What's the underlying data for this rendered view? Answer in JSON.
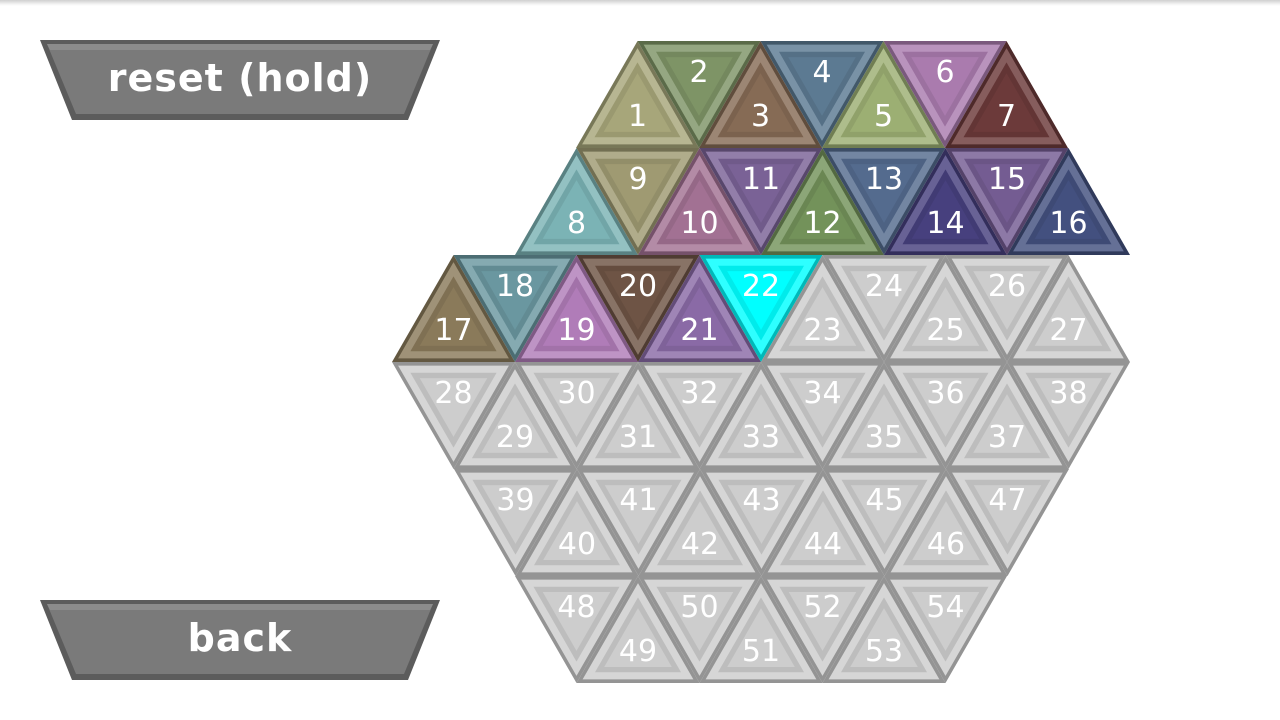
{
  "buttons": {
    "reset_label": "reset (hold)",
    "back_label": "back"
  },
  "colors": {
    "button_face": "#7a7a7a",
    "button_edge": "#5c5c5c",
    "empty_tile": "#cdcdcd",
    "selected_tile": "#00ffff",
    "label": "#ffffff"
  },
  "board": {
    "shape": "hexagon",
    "rows": [
      {
        "first": 1,
        "count": 7,
        "first_points_up": true
      },
      {
        "first": 8,
        "count": 9,
        "first_points_up": true
      },
      {
        "first": 17,
        "count": 11,
        "first_points_up": true
      },
      {
        "first": 28,
        "count": 11,
        "first_points_up": false
      },
      {
        "first": 39,
        "count": 9,
        "first_points_up": false
      },
      {
        "first": 48,
        "count": 7,
        "first_points_up": false
      }
    ],
    "selected_tile": 22,
    "tiles": [
      {
        "n": 1,
        "color": "#a7a67a"
      },
      {
        "n": 2,
        "color": "#7e9466"
      },
      {
        "n": 3,
        "color": "#866b55"
      },
      {
        "n": 4,
        "color": "#5c7a92"
      },
      {
        "n": 5,
        "color": "#9caf73"
      },
      {
        "n": 6,
        "color": "#aa7bae"
      },
      {
        "n": 7,
        "color": "#6c3a3a"
      },
      {
        "n": 8,
        "color": "#7bb3b5"
      },
      {
        "n": 9,
        "color": "#9f9a72"
      },
      {
        "n": 10,
        "color": "#a27193"
      },
      {
        "n": 11,
        "color": "#7a6296"
      },
      {
        "n": 12,
        "color": "#73925a"
      },
      {
        "n": 13,
        "color": "#546b8e"
      },
      {
        "n": 14,
        "color": "#47407e"
      },
      {
        "n": 15,
        "color": "#745c92"
      },
      {
        "n": 16,
        "color": "#43507f"
      },
      {
        "n": 17,
        "color": "#8a7a5a"
      },
      {
        "n": 18,
        "color": "#6a97a0"
      },
      {
        "n": 19,
        "color": "#b07cb8"
      },
      {
        "n": 20,
        "color": "#6e5445"
      },
      {
        "n": 21,
        "color": "#8a6aa6"
      },
      {
        "n": 22,
        "color": "#00ffff"
      },
      {
        "n": 23,
        "color": "#cdcdcd"
      },
      {
        "n": 24,
        "color": "#cdcdcd"
      },
      {
        "n": 25,
        "color": "#cdcdcd"
      },
      {
        "n": 26,
        "color": "#cdcdcd"
      },
      {
        "n": 27,
        "color": "#cdcdcd"
      },
      {
        "n": 28,
        "color": "#cdcdcd"
      },
      {
        "n": 29,
        "color": "#cdcdcd"
      },
      {
        "n": 30,
        "color": "#cdcdcd"
      },
      {
        "n": 31,
        "color": "#cdcdcd"
      },
      {
        "n": 32,
        "color": "#cdcdcd"
      },
      {
        "n": 33,
        "color": "#cdcdcd"
      },
      {
        "n": 34,
        "color": "#cdcdcd"
      },
      {
        "n": 35,
        "color": "#cdcdcd"
      },
      {
        "n": 36,
        "color": "#cdcdcd"
      },
      {
        "n": 37,
        "color": "#cdcdcd"
      },
      {
        "n": 38,
        "color": "#cdcdcd"
      },
      {
        "n": 39,
        "color": "#cdcdcd"
      },
      {
        "n": 40,
        "color": "#cdcdcd"
      },
      {
        "n": 41,
        "color": "#cdcdcd"
      },
      {
        "n": 42,
        "color": "#cdcdcd"
      },
      {
        "n": 43,
        "color": "#cdcdcd"
      },
      {
        "n": 44,
        "color": "#cdcdcd"
      },
      {
        "n": 45,
        "color": "#cdcdcd"
      },
      {
        "n": 46,
        "color": "#cdcdcd"
      },
      {
        "n": 47,
        "color": "#cdcdcd"
      },
      {
        "n": 48,
        "color": "#cdcdcd"
      },
      {
        "n": 49,
        "color": "#cdcdcd"
      },
      {
        "n": 50,
        "color": "#cdcdcd"
      },
      {
        "n": 51,
        "color": "#cdcdcd"
      },
      {
        "n": 52,
        "color": "#cdcdcd"
      },
      {
        "n": 53,
        "color": "#cdcdcd"
      },
      {
        "n": 54,
        "color": "#cdcdcd"
      }
    ]
  }
}
